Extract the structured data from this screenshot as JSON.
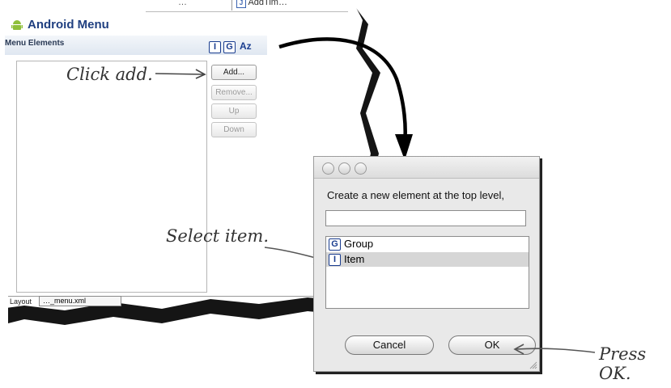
{
  "editor": {
    "top_tabs": [
      "…",
      "AddTim…"
    ],
    "top_tab_icon": "J",
    "title": "Android Menu",
    "section": "Menu Elements",
    "toolbar_icons": [
      "I",
      "G",
      "Az"
    ],
    "buttons": {
      "add": "Add...",
      "remove": "Remove...",
      "up": "Up",
      "down": "Down"
    },
    "layout_label": "Layout",
    "file_tab": "…_menu.xml"
  },
  "dialog": {
    "prompt": "Create a new element at the top level,",
    "search_value": "",
    "items": [
      {
        "icon": "G",
        "label": "Group",
        "selected": false
      },
      {
        "icon": "I",
        "label": "Item",
        "selected": true
      }
    ],
    "cancel_label": "Cancel",
    "ok_label": "OK"
  },
  "annotations": {
    "click_add": "Click add.",
    "select_item": "Select item.",
    "press_ok": "Press OK."
  }
}
